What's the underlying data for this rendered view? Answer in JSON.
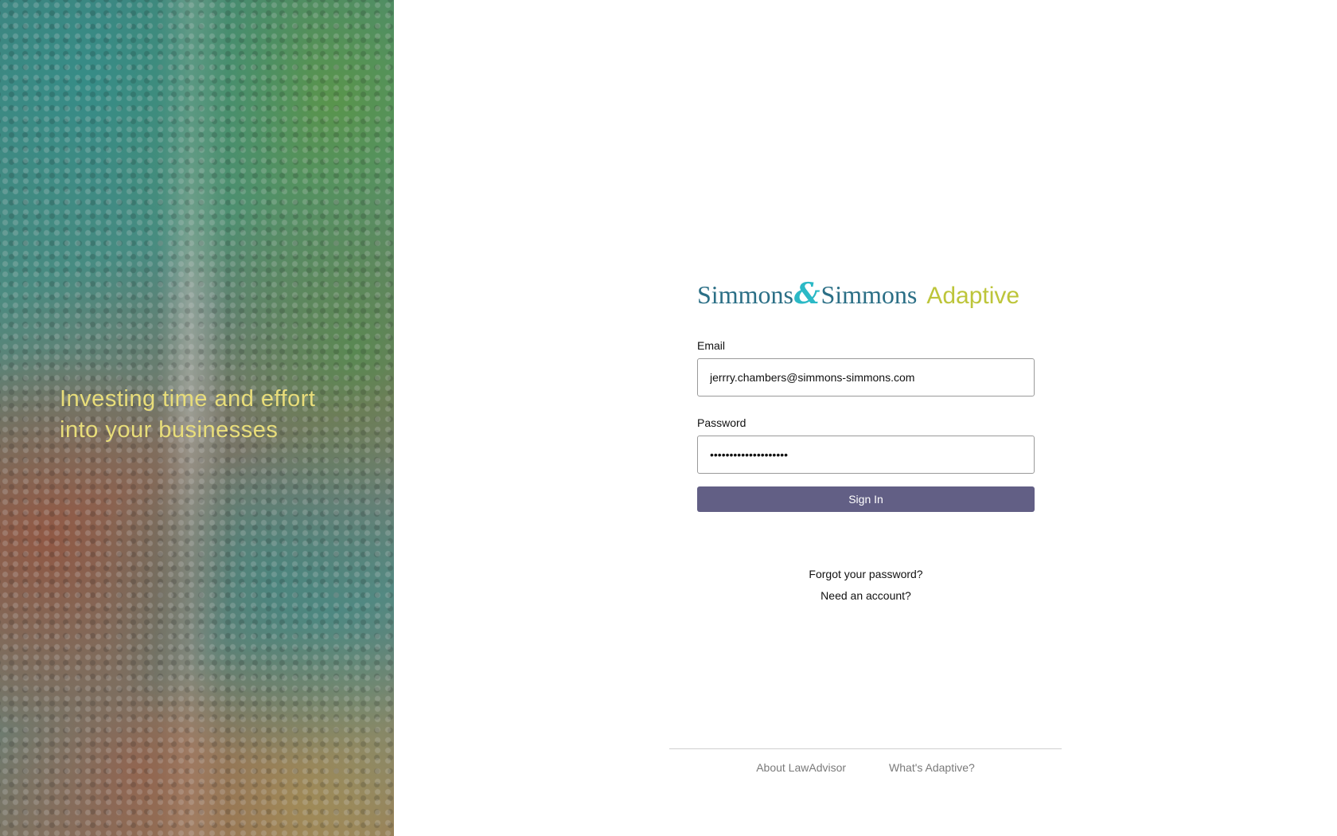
{
  "hero": {
    "tagline_line1": "Investing time and effort",
    "tagline_line2": "into your businesses"
  },
  "logo": {
    "brand_left": "Simmons",
    "ampersand": "&",
    "brand_right": "Simmons",
    "product": "Adaptive",
    "colors": {
      "brand": "#2b6f86",
      "ampersand": "#2bb9c6",
      "product": "#bdc53a"
    }
  },
  "form": {
    "email_label": "Email",
    "email_value": "jerrry.chambers@simmons-simmons.com",
    "password_label": "Password",
    "password_value": "••••••••••••••••••••",
    "submit_label": "Sign In",
    "submit_color": "#625f85"
  },
  "links": {
    "forgot_password": "Forgot your password?",
    "need_account": "Need an account?"
  },
  "footer": {
    "about": "About LawAdvisor",
    "whats_adaptive": "What's Adaptive?"
  }
}
